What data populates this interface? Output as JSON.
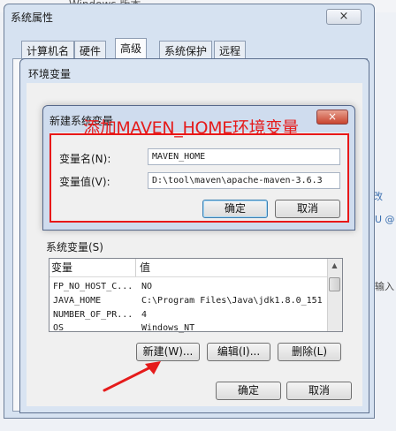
{
  "background": {
    "heading": "Windows 版本",
    "right_link_1": "改",
    "right_link_2": "U @",
    "right_text_3": "输入"
  },
  "system_properties": {
    "title": "系统属性",
    "close_glyph": "×",
    "tabs": [
      {
        "label": "计算机名"
      },
      {
        "label": "硬件"
      },
      {
        "label": "高级"
      },
      {
        "label": "系统保护"
      },
      {
        "label": "远程"
      }
    ],
    "active_tab": "高级"
  },
  "env_dialog": {
    "title": "环境变量",
    "system_vars_label": "系统变量(S)",
    "columns": [
      "变量",
      "值"
    ],
    "rows": [
      {
        "name": "FP_NO_HOST_C...",
        "value": "NO"
      },
      {
        "name": "JAVA_HOME",
        "value": "C:\\Program Files\\Java\\jdk1.8.0_151"
      },
      {
        "name": "NUMBER_OF_PR...",
        "value": "4"
      },
      {
        "name": "OS",
        "value": "Windows_NT"
      }
    ],
    "buttons": {
      "new": "新建(W)...",
      "edit": "编辑(I)...",
      "delete": "删除(L)",
      "ok": "确定",
      "cancel": "取消"
    }
  },
  "new_var_dialog": {
    "title": "新建系统变量",
    "close_glyph": "×",
    "annotation": "添加MAVEN_HOME环境变量",
    "name_label": "变量名(N):",
    "value_label": "变量值(V):",
    "name_value": "MAVEN_HOME",
    "value_value": "D:\\tool\\maven\\apache-maven-3.6.3",
    "ok": "确定",
    "cancel": "取消"
  },
  "colors": {
    "annotation_red": "#e51b1b",
    "window_frame": "#d9e4f2"
  }
}
